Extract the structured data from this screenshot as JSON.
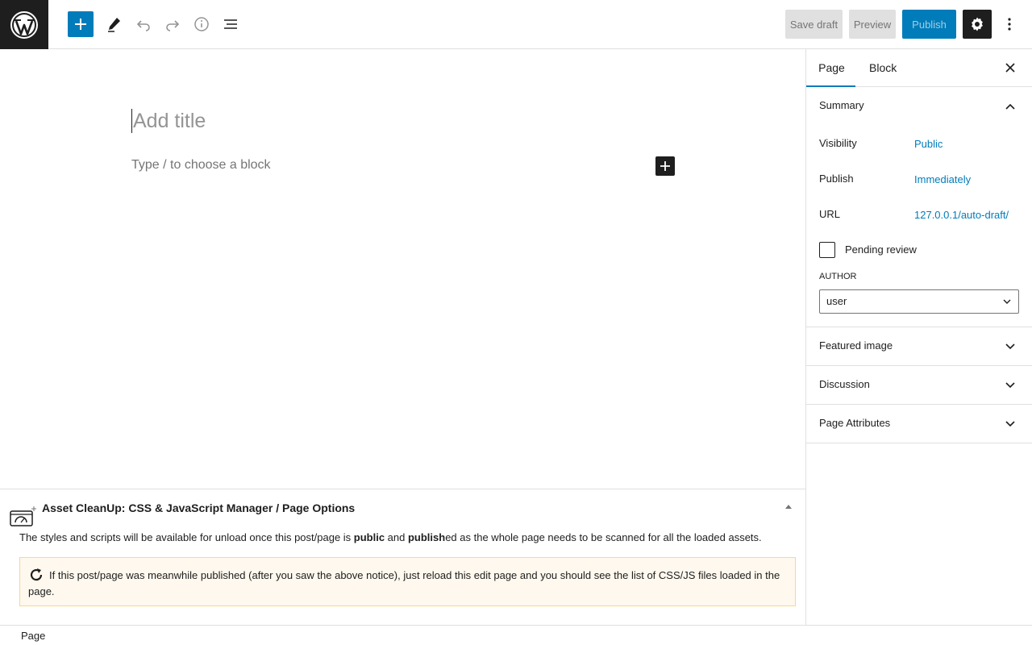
{
  "toolbar": {
    "add_block_label": "Toggle block inserter",
    "save_draft": "Save draft",
    "preview": "Preview",
    "publish": "Publish"
  },
  "editor": {
    "title_placeholder": "Add title",
    "block_placeholder": "Type / to choose a block"
  },
  "sidebar": {
    "tabs": [
      {
        "label": "Page"
      },
      {
        "label": "Block"
      }
    ],
    "summary": {
      "title": "Summary",
      "visibility_label": "Visibility",
      "visibility_value": "Public",
      "publish_label": "Publish",
      "publish_value": "Immediately",
      "url_label": "URL",
      "url_value": "127.0.0.1/auto-draft/",
      "pending_label": "Pending review",
      "author_label": "AUTHOR",
      "author_value": "user"
    },
    "panels": [
      {
        "label": "Featured image"
      },
      {
        "label": "Discussion"
      },
      {
        "label": "Page Attributes"
      }
    ]
  },
  "metabox": {
    "title": "Asset CleanUp: CSS & JavaScript Manager / Page Options",
    "text_before": "The styles and scripts will be available for unload once this post/page is ",
    "bold1": "public",
    "text_mid": " and ",
    "bold2": "publish",
    "text_after": "ed as the whole page needs to be scanned for all the loaded assets.",
    "notice": "If this post/page was meanwhile published (after you saw the above notice), just reload this edit page and you should see the list of CSS/JS files loaded in the page."
  },
  "footer": {
    "breadcrumb": "Page"
  },
  "colors": {
    "accent": "#007cba",
    "dark": "#1e1e1e",
    "notice_bg": "#fef8ee"
  }
}
